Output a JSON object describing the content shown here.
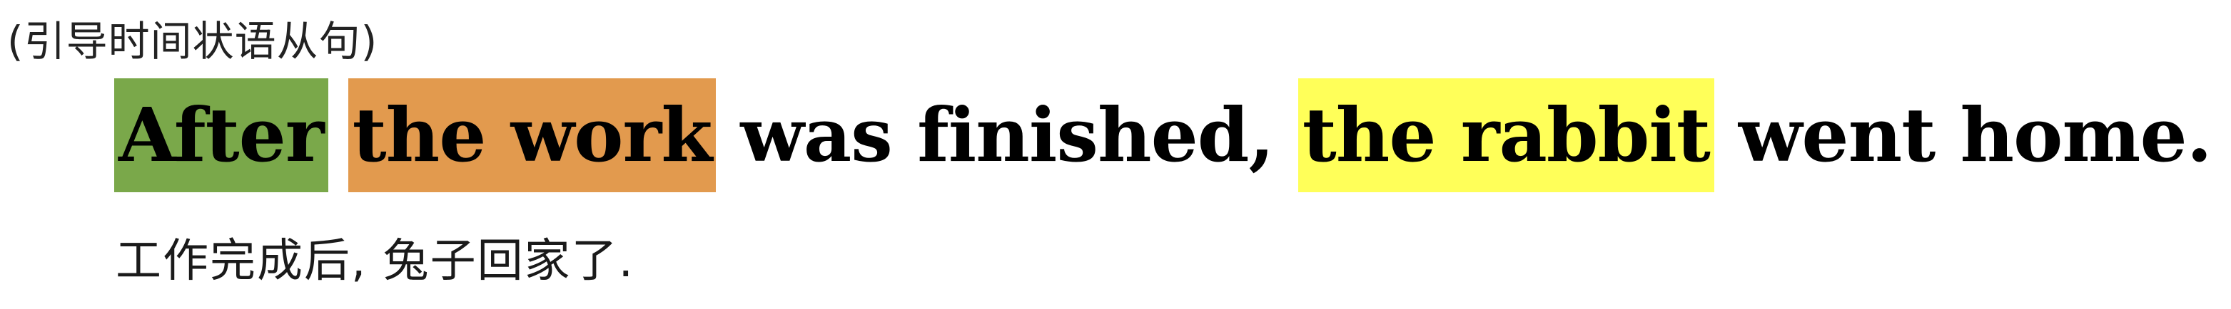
{
  "caption": "(引导时间状语从句)",
  "sentence": {
    "segments": [
      {
        "text": "After",
        "highlight": "#7aa84a"
      },
      {
        "text": "the work",
        "highlight": "#e29a4e"
      },
      {
        "text": "was finished,",
        "highlight": ""
      },
      {
        "text": "the rabbit",
        "highlight": "#ffff59"
      },
      {
        "text": "went home.",
        "highlight": ""
      }
    ]
  },
  "translation": "工作完成后, 兔子回家了."
}
